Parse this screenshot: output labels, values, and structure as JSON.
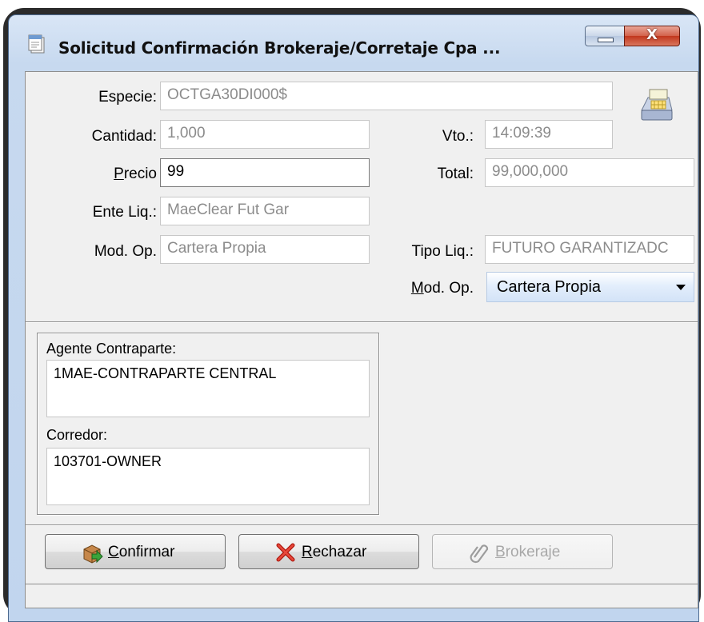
{
  "window": {
    "title": "Solicitud Confirmación Brokeraje/Corretaje Cpa ...",
    "minimize_label": "",
    "close_label": "X"
  },
  "form": {
    "especie": {
      "label": "Especie:",
      "value": "OCTGA30DI000$"
    },
    "cantidad": {
      "label": "Cantidad:",
      "value": "1,000"
    },
    "vto": {
      "label": "Vto.:",
      "value": "14:09:39"
    },
    "precio": {
      "label_prefix": "",
      "label_accel": "P",
      "label_rest": "recio",
      "value": "99"
    },
    "total": {
      "label": "Total:",
      "value": "99,000,000"
    },
    "ente_liq": {
      "label": "Ente Liq.:",
      "value": "MaeClear Fut Gar"
    },
    "mod_op_left": {
      "label": "Mod. Op.",
      "value": "Cartera Propia"
    },
    "tipo_liq": {
      "label": "Tipo Liq.:",
      "value": "FUTURO GARANTIZADC"
    },
    "mod_op_right": {
      "label_accel": "M",
      "label_rest": "od. Op.",
      "selected": "Cartera Propia"
    }
  },
  "parties": {
    "agente_label": "Agente Contraparte:",
    "agente_value": "1MAE-CONTRAPARTE CENTRAL",
    "corredor_label": "Corredor:",
    "corredor_value": "103701-OWNER"
  },
  "buttons": {
    "confirmar": {
      "accel": "C",
      "rest": "onfirmar",
      "icon": "box-confirm-icon",
      "enabled": true
    },
    "rechazar": {
      "accel": "R",
      "rest": "echazar",
      "icon": "red-x-icon",
      "enabled": true
    },
    "brokeraje": {
      "accel": "B",
      "rest": "rokeraje",
      "icon": "paperclip-icon",
      "enabled": false
    }
  }
}
